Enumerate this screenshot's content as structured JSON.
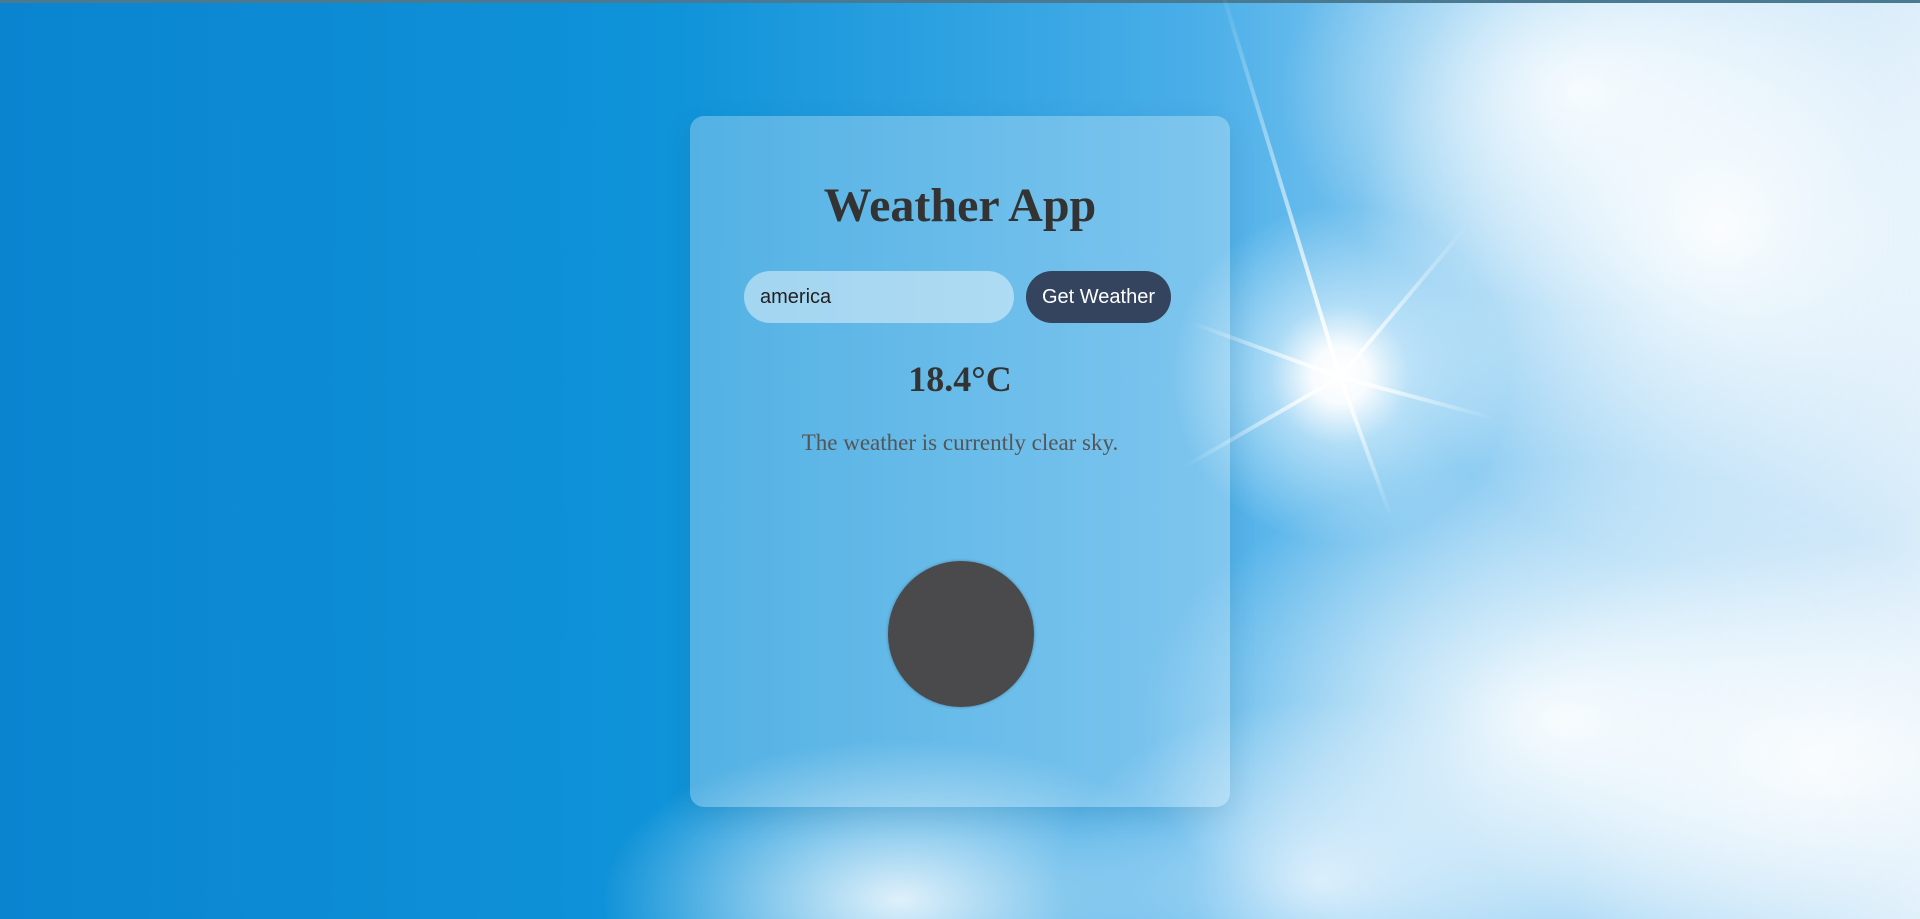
{
  "app": {
    "title": "Weather App"
  },
  "search": {
    "value": "america",
    "button_label": "Get Weather"
  },
  "result": {
    "temperature": "18.4°C",
    "description": "The weather is currently clear sky.",
    "icon": "weather-condition-icon"
  },
  "colors": {
    "button_background": "#34445e",
    "title_text": "#333333",
    "icon_fill": "#4a4a4c"
  }
}
